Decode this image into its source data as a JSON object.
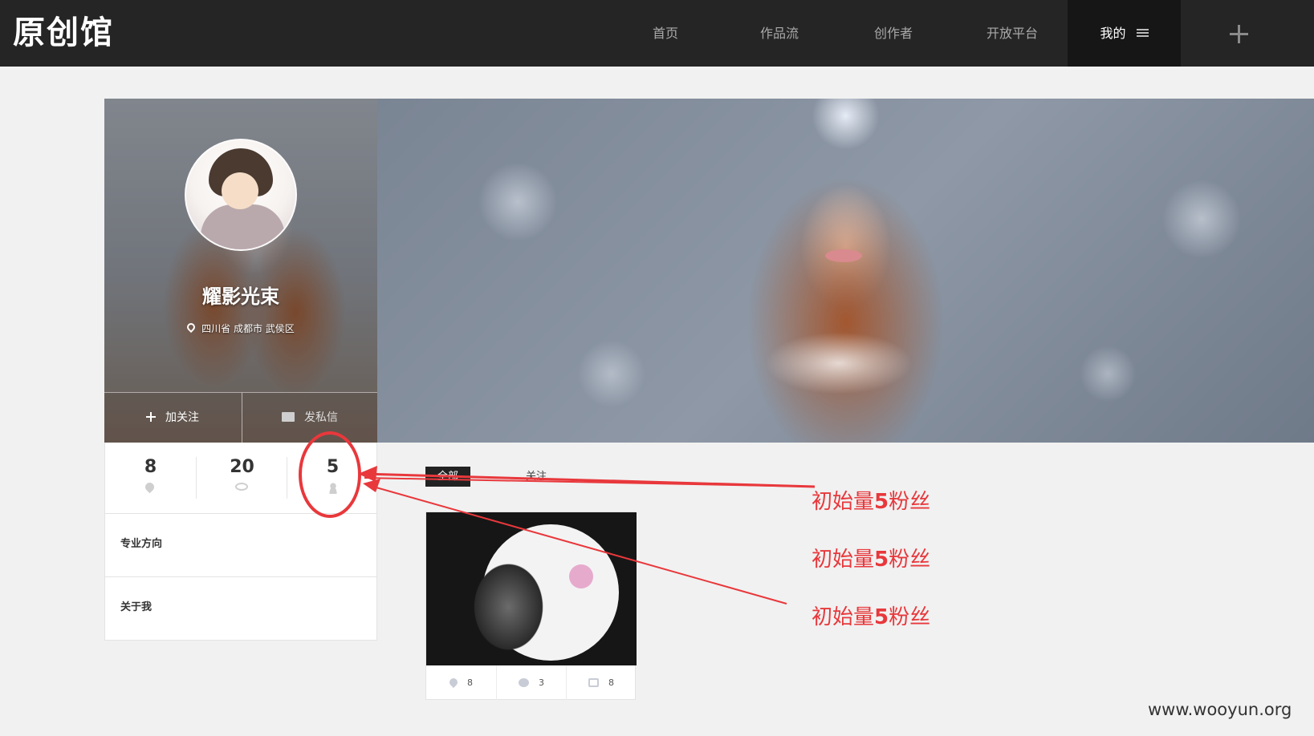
{
  "site": {
    "logo_text": "原创馆"
  },
  "nav": {
    "items": [
      {
        "label": "首页"
      },
      {
        "label": "作品流"
      },
      {
        "label": "创作者"
      },
      {
        "label": "开放平台"
      },
      {
        "label": "我的"
      }
    ],
    "active": "我的"
  },
  "profile": {
    "name": "耀影光束",
    "location": "四川省 成都市 武侯区",
    "follow_label": "加关注",
    "message_label": "发私信"
  },
  "stats": {
    "likes": "8",
    "views": "20",
    "fans": "5"
  },
  "sections": {
    "specialty": "专业方向",
    "about": "关于我"
  },
  "tabs": {
    "all": "全部",
    "follow": "关注"
  },
  "work": {
    "likes": "8",
    "comments": "3",
    "shares": "8"
  },
  "annotation": {
    "line1_prefix": "初始量",
    "line1_num": "5",
    "line1_suffix": "粉丝",
    "line2_prefix": "初始量",
    "line2_num": "5",
    "line2_suffix": "粉丝",
    "line3_prefix": "初始量",
    "line3_num": "5",
    "line3_suffix": "粉丝",
    "color": "#e8383c"
  },
  "watermark": "www.wooyun.org",
  "colors": {
    "topbar": "#252525",
    "topbar_active": "#161616",
    "page_bg": "#f1f1f1"
  }
}
